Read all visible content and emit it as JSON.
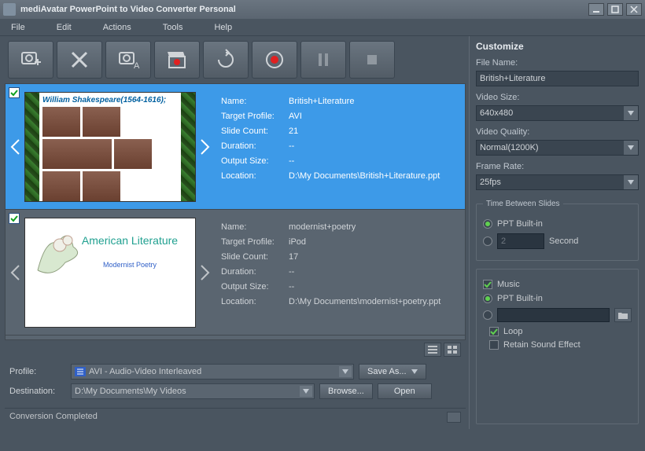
{
  "titlebar": {
    "title": "mediAvatar PowerPoint to Video Converter Personal"
  },
  "menu": {
    "file": "File",
    "edit": "Edit",
    "actions": "Actions",
    "tools": "Tools",
    "help": "Help"
  },
  "items": [
    {
      "checked": true,
      "thumbCaption": "William Shakespeare(1564-1616);",
      "name": "British+Literature",
      "targetProfile": "AVI",
      "slideCount": "21",
      "duration": "--",
      "outputSize": "--",
      "location": "D:\\My Documents\\British+Literature.ppt"
    },
    {
      "checked": true,
      "thumbTitle": "American Literature",
      "thumbSub": "Modernist Poetry",
      "name": "modernist+poetry",
      "targetProfile": "iPod",
      "slideCount": "17",
      "duration": "--",
      "outputSize": "--",
      "location": "D:\\My Documents\\modernist+poetry.ppt"
    }
  ],
  "labels": {
    "name": "Name:",
    "targetProfile": "Target Profile:",
    "slideCount": "Slide Count:",
    "duration": "Duration:",
    "outputSize": "Output Size:",
    "location": "Location:"
  },
  "bottom": {
    "profileLabel": "Profile:",
    "profileValue": "AVI - Audio-Video Interleaved",
    "saveAs": "Save As...",
    "destinationLabel": "Destination:",
    "destinationValue": "D:\\My Documents\\My Videos",
    "browse": "Browse...",
    "open": "Open"
  },
  "status": {
    "text": "Conversion Completed"
  },
  "customize": {
    "title": "Customize",
    "fileNameLabel": "File Name:",
    "fileNameValue": "British+Literature",
    "videoSizeLabel": "Video Size:",
    "videoSizeValue": "640x480",
    "videoQualityLabel": "Video Quality:",
    "videoQualityValue": "Normal(1200K)",
    "frameRateLabel": "Frame Rate:",
    "frameRateValue": "25fps",
    "timeBetweenLabel": "Time Between Slides",
    "pptBuiltIn": "PPT Built-in",
    "customSecValue": "2",
    "secondLabel": "Second",
    "musicLabel": "Music",
    "loopLabel": "Loop",
    "retainLabel": "Retain Sound Effect"
  }
}
